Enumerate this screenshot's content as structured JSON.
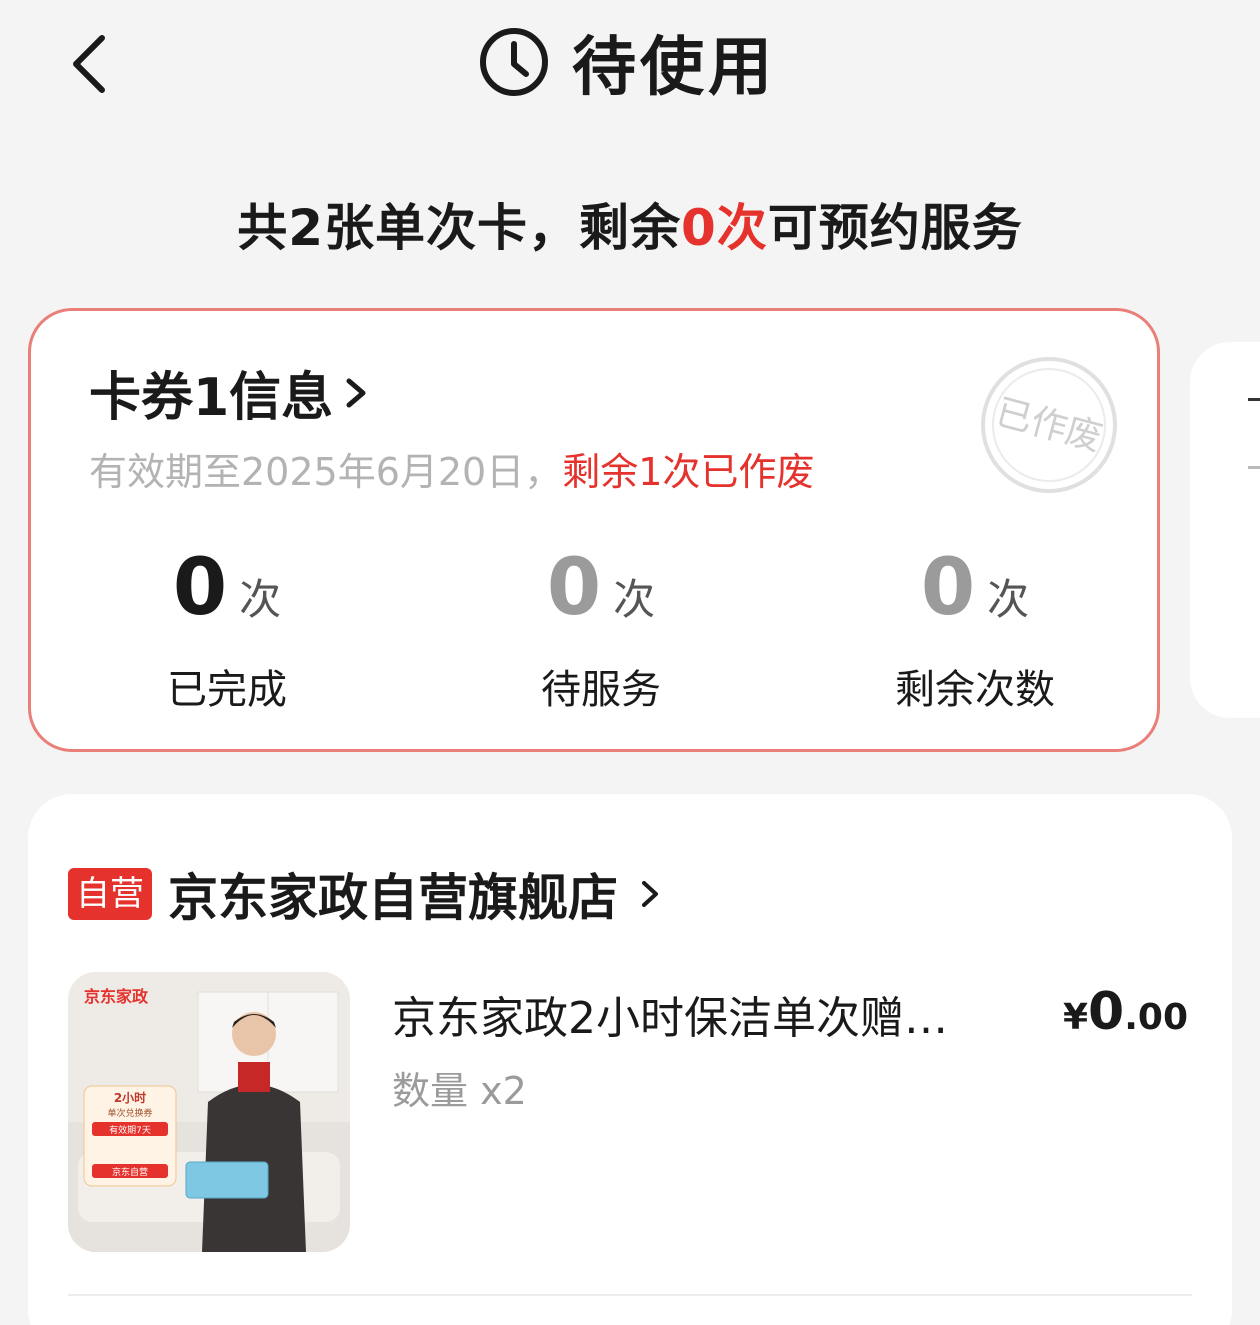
{
  "header": {
    "title": "待使用",
    "back_icon": "chevron-left-icon",
    "status_icon": "clock-icon"
  },
  "summary": {
    "prefix": "共2张单次卡，剩余",
    "highlight": "0次",
    "suffix": "可预约服务"
  },
  "card1": {
    "title": "卡券1信息",
    "validity_prefix": "有效期至2025年6月20日，",
    "validity_status": "剩余1次已作废",
    "stamp_text": "已作废",
    "stats": [
      {
        "value": "0",
        "unit": "次",
        "label": "已完成"
      },
      {
        "value": "0",
        "unit": "次",
        "label": "待服务"
      },
      {
        "value": "0",
        "unit": "次",
        "label": "剩余次数"
      }
    ]
  },
  "order": {
    "badge": "自营",
    "shop_name": "京东家政自营旗舰店",
    "product": {
      "title": "京东家政2小时保洁单次赠…",
      "quantity": "数量 x2",
      "price_currency": "¥",
      "price_int": "0",
      "price_dec": ".00",
      "image_brand": "京东家政",
      "image_tag_1": "2小时",
      "image_tag_2": "单次兑换券",
      "image_tag_3": "有效期7天",
      "image_tag_4": "京东自营"
    }
  },
  "colors": {
    "accent": "#e5322d",
    "card_border": "#ea7e78",
    "muted": "#9b9b9b"
  }
}
